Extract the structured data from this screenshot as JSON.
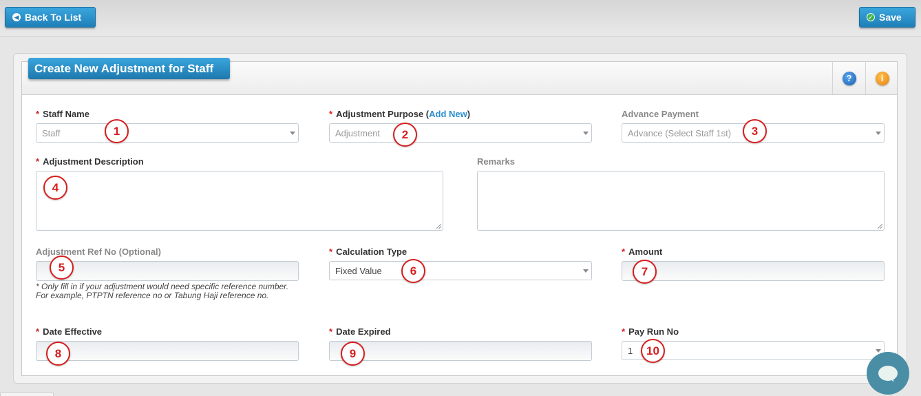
{
  "toolbar": {
    "back_label": "Back To List",
    "save_label": "Save"
  },
  "panel": {
    "title": "Create New Adjustment for Staff",
    "help_glyph": "?",
    "info_glyph": "i"
  },
  "form": {
    "required_mark": "*",
    "staff_name": {
      "label": "Staff Name",
      "value": "Staff"
    },
    "adjustment_purpose": {
      "label": "Adjustment Purpose (",
      "add_new": "Add New",
      "label_close": ")",
      "value": "Adjustment"
    },
    "advance_payment": {
      "label": "Advance Payment",
      "value": "Advance (Select Staff 1st)"
    },
    "adjustment_description": {
      "label": "Adjustment Description",
      "value": ""
    },
    "remarks": {
      "label": "Remarks",
      "value": ""
    },
    "adjustment_ref_no": {
      "label": "Adjustment Ref No (Optional)",
      "value": "",
      "hint": "* Only fill in if your adjustment would need specific reference number. For example, PTPTN reference no or Tabung Haji reference no."
    },
    "calculation_type": {
      "label": "Calculation Type",
      "value": "Fixed Value"
    },
    "amount": {
      "label": "Amount",
      "value": ""
    },
    "date_effective": {
      "label": "Date Effective",
      "value": ""
    },
    "date_expired": {
      "label": "Date Expired",
      "value": ""
    },
    "pay_run_no": {
      "label": "Pay Run No",
      "value": "1"
    }
  },
  "annotations": [
    "1",
    "2",
    "3",
    "4",
    "5",
    "6",
    "7",
    "8",
    "9",
    "10"
  ],
  "icons": {
    "back": "arrow-left-icon",
    "save": "check-icon",
    "help": "help-icon",
    "info": "info-icon",
    "chat": "chat-icon"
  },
  "colors": {
    "primary_button": "#1f7fb8",
    "required": "#d21f1f",
    "annotation": "#d71e1e",
    "link": "#2a8fcf",
    "chat": "#4a8ea6"
  }
}
